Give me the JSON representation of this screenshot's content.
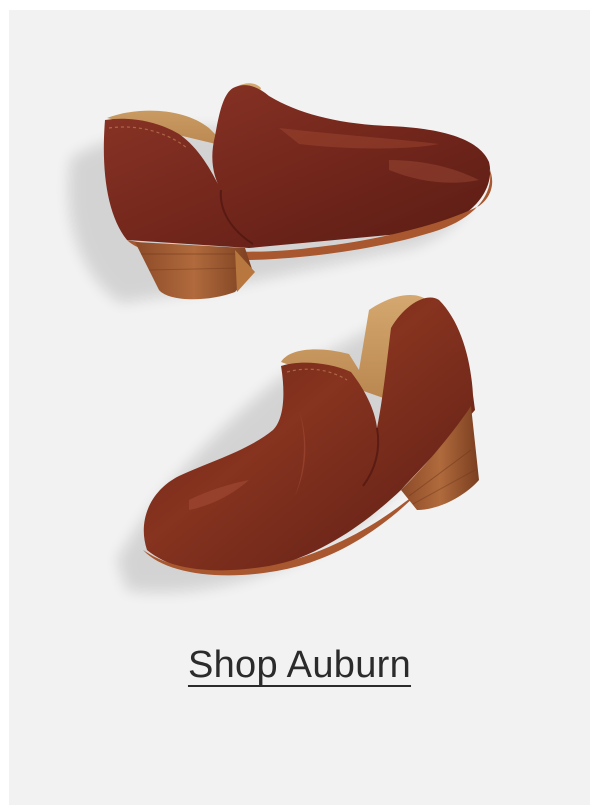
{
  "cta": {
    "label": "Shop Auburn"
  },
  "image": {
    "subject": "boots-icon",
    "leather_color": "#7a2a1f",
    "heel_color": "#a35d33",
    "lining_color": "#c99a62"
  },
  "colors": {
    "background": "#f2f2f2",
    "text": "#2b2b2b"
  }
}
